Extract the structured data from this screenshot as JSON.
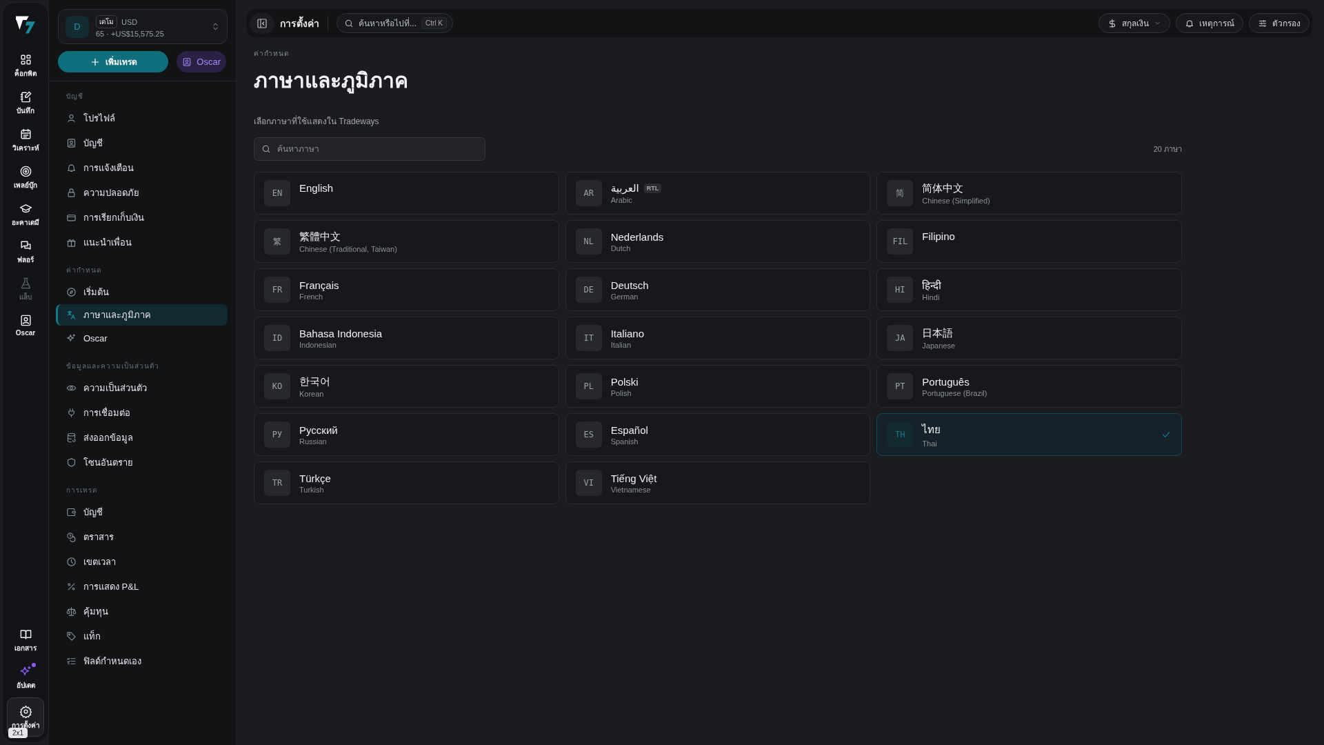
{
  "rail": {
    "items": [
      {
        "label": "ค็อกพิต",
        "selected": false,
        "disabled": false,
        "new": false
      },
      {
        "label": "บันทึก",
        "selected": false,
        "disabled": false,
        "new": false
      },
      {
        "label": "วิเคราะห์",
        "selected": false,
        "disabled": false,
        "new": false
      },
      {
        "label": "เพลย์บุ๊ก",
        "selected": false,
        "disabled": false,
        "new": false
      },
      {
        "label": "อะคาเดมี",
        "selected": false,
        "disabled": false,
        "new": false
      },
      {
        "label": "ฟลอร์",
        "selected": false,
        "disabled": false,
        "new": false
      },
      {
        "label": "แล็บ",
        "selected": false,
        "disabled": true,
        "new": false
      },
      {
        "label": "Oscar",
        "selected": false,
        "disabled": false,
        "new": false
      }
    ],
    "bottom_items": [
      {
        "label": "เอกสาร",
        "selected": false,
        "disabled": false,
        "new": false
      },
      {
        "label": "อัปเดต",
        "selected": false,
        "disabled": false,
        "new": true
      },
      {
        "label": "การตั้งค่า",
        "selected": true,
        "disabled": false,
        "new": false
      }
    ],
    "badge": "2x1"
  },
  "sidebar": {
    "account": {
      "avatar": "D",
      "tag": "เดโม",
      "currency": "USD",
      "summary": "65 · +US$15,575.25"
    },
    "actions": [
      {
        "label": "เพิ่มเทรด",
        "kind": "primary"
      },
      {
        "label": "Oscar",
        "kind": "assistant"
      }
    ],
    "sections": [
      {
        "title": "บัญชี",
        "items": [
          {
            "label": "โปรไฟล์",
            "selected": false
          },
          {
            "label": "บัญชี",
            "selected": false
          },
          {
            "label": "การแจ้งเตือน",
            "selected": false
          },
          {
            "label": "ความปลอดภัย",
            "selected": false
          },
          {
            "label": "การเรียกเก็บเงิน",
            "selected": false
          },
          {
            "label": "แนะนำเพื่อน",
            "selected": false
          }
        ]
      },
      {
        "title": "ค่ากำหนด",
        "items": [
          {
            "label": "เริ่มต้น",
            "selected": false
          },
          {
            "label": "ภาษาและภูมิภาค",
            "selected": true
          },
          {
            "label": "Oscar",
            "selected": false
          }
        ]
      },
      {
        "title": "ข้อมูลและความเป็นส่วนตัว",
        "items": [
          {
            "label": "ความเป็นส่วนตัว",
            "selected": false
          },
          {
            "label": "การเชื่อมต่อ",
            "selected": false
          },
          {
            "label": "ส่งออกข้อมูล",
            "selected": false
          },
          {
            "label": "โซนอันตราย",
            "selected": false
          }
        ]
      },
      {
        "title": "การเทรด",
        "items": [
          {
            "label": "บัญชี",
            "selected": false
          },
          {
            "label": "ตราสาร",
            "selected": false
          },
          {
            "label": "เขตเวลา",
            "selected": false
          },
          {
            "label": "การแสดง P&L",
            "selected": false
          },
          {
            "label": "คุ้มทุน",
            "selected": false
          },
          {
            "label": "แท็ก",
            "selected": false
          },
          {
            "label": "ฟิลด์กำหนดเอง",
            "selected": false
          }
        ]
      }
    ]
  },
  "topbar": {
    "title": "การตั้งค่า",
    "search": {
      "placeholder": "ค้นหาหรือไปที่...",
      "shortcut": "Ctrl K"
    },
    "buttons": [
      {
        "label": "สกุลเงิน",
        "kind": "currency",
        "dropdown": true
      },
      {
        "label": "เหตุการณ์",
        "kind": "events",
        "dropdown": false
      },
      {
        "label": "ตัวกรอง",
        "kind": "filters",
        "dropdown": false
      }
    ]
  },
  "page": {
    "breadcrumb": "ค่ากำหนด",
    "title": "ภาษาและภูมิภาค",
    "description": "เลือกภาษาที่ใช้แสดงใน Tradeways",
    "search": {
      "placeholder": "ค้นหาภาษา"
    },
    "count": "20 ภาษา",
    "languages": [
      {
        "code": "EN",
        "name": "English",
        "selected": false
      },
      {
        "code": "AR",
        "name": "العربية",
        "english": "Arabic",
        "tag": "RTL",
        "selected": false
      },
      {
        "code": "简",
        "name": "简体中文",
        "english": "Chinese (Simplified)",
        "selected": false
      },
      {
        "code": "繁",
        "name": "繁體中文",
        "english": "Chinese (Traditional, Taiwan)",
        "selected": false
      },
      {
        "code": "NL",
        "name": "Nederlands",
        "english": "Dutch",
        "selected": false
      },
      {
        "code": "FIL",
        "name": "Filipino",
        "selected": false
      },
      {
        "code": "FR",
        "name": "Français",
        "english": "French",
        "selected": false
      },
      {
        "code": "DE",
        "name": "Deutsch",
        "english": "German",
        "selected": false
      },
      {
        "code": "HI",
        "name": "हिन्दी",
        "english": "Hindi",
        "selected": false
      },
      {
        "code": "ID",
        "name": "Bahasa Indonesia",
        "english": "Indonesian",
        "selected": false
      },
      {
        "code": "IT",
        "name": "Italiano",
        "english": "Italian",
        "selected": false
      },
      {
        "code": "JA",
        "name": "日本語",
        "english": "Japanese",
        "selected": false
      },
      {
        "code": "KO",
        "name": "한국어",
        "english": "Korean",
        "selected": false
      },
      {
        "code": "PL",
        "name": "Polski",
        "english": "Polish",
        "selected": false
      },
      {
        "code": "PT",
        "name": "Português",
        "english": "Portuguese (Brazil)",
        "selected": false
      },
      {
        "code": "РУ",
        "name": "Русский",
        "english": "Russian",
        "selected": false
      },
      {
        "code": "ES",
        "name": "Español",
        "english": "Spanish",
        "selected": false
      },
      {
        "code": "TH",
        "name": "ไทย",
        "english": "Thai",
        "selected": true
      },
      {
        "code": "TR",
        "name": "Türkçe",
        "english": "Turkish",
        "selected": false
      },
      {
        "code": "VI",
        "name": "Tiếng Việt",
        "english": "Vietnamese",
        "selected": false
      }
    ]
  }
}
